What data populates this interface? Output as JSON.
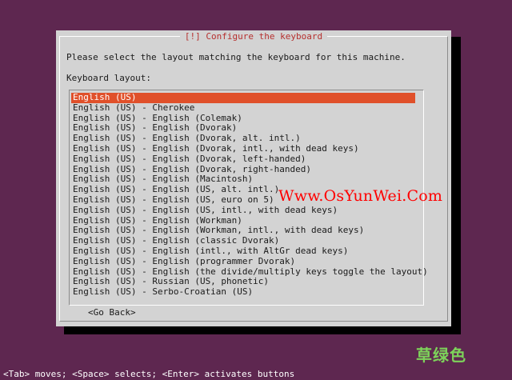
{
  "dialog": {
    "title": "[!] Configure the keyboard",
    "prompt": "Please select the layout matching the keyboard for this machine.",
    "list_label": "Keyboard layout:",
    "selected_index": 0,
    "layouts": [
      "English (US)",
      "English (US) - Cherokee",
      "English (US) - English (Colemak)",
      "English (US) - English (Dvorak)",
      "English (US) - English (Dvorak, alt. intl.)",
      "English (US) - English (Dvorak, intl., with dead keys)",
      "English (US) - English (Dvorak, left-handed)",
      "English (US) - English (Dvorak, right-handed)",
      "English (US) - English (Macintosh)",
      "English (US) - English (US, alt. intl.)",
      "English (US) - English (US, euro on 5)",
      "English (US) - English (US, intl., with dead keys)",
      "English (US) - English (Workman)",
      "English (US) - English (Workman, intl., with dead keys)",
      "English (US) - English (classic Dvorak)",
      "English (US) - English (intl., with AltGr dead keys)",
      "English (US) - English (programmer Dvorak)",
      "English (US) - English (the divide/multiply keys toggle the layout)",
      "English (US) - Russian (US, phonetic)",
      "English (US) - Serbo-Croatian (US)"
    ],
    "go_back_label": "<Go Back>"
  },
  "watermark": "Www.OsYunWei.Com",
  "footer_hint": "<Tab> moves; <Space> selects; <Enter> activates buttons",
  "logo_text": "草绿色",
  "colors": {
    "background": "#5e2750",
    "dialog": "#d3d3d3",
    "selection": "#e0502a",
    "title": "#b6302f",
    "watermark": "#ff0000",
    "logo": "#7dd35a"
  }
}
